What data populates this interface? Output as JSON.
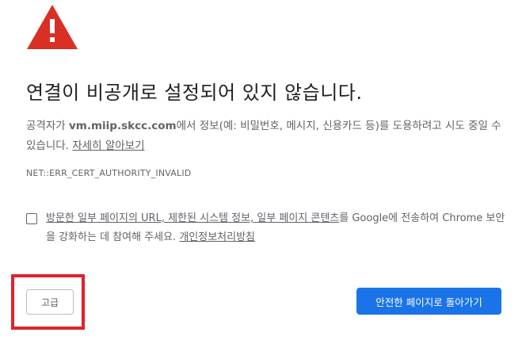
{
  "icon": {
    "name": "warning-triangle-icon",
    "color": "#d93025",
    "glyph": "!"
  },
  "heading": "연결이 비공개로 설정되어 있지 않습니다.",
  "body": {
    "prefix": "공격자가 ",
    "host": "vm.miip.skcc.com",
    "suffix": "에서 정보(예: 비밀번호, 메시지, 신용카드 등)를 도용하려고 시도 중일 수 있습니다. ",
    "learn_more_link": "자세히 알아보기"
  },
  "error_code": "NET::ERR_CERT_AUTHORITY_INVALID",
  "opt_in": {
    "checked": false,
    "text_underlined": "방문한 일부 페이지의 URL, 제한된 시스템 정보, 일부 페이지 콘텐츠",
    "text_rest": "를 Google에 전송하여 Chrome 보안을 강화하는 데 참여해 주세요. ",
    "privacy_link": "개인정보처리방침"
  },
  "buttons": {
    "advanced_label": "고급",
    "back_to_safety_label": "안전한 페이지로 돌아가기"
  },
  "colors": {
    "accent": "#1a73e8",
    "highlight": "#e0222b",
    "text_secondary": "#5f6368"
  }
}
